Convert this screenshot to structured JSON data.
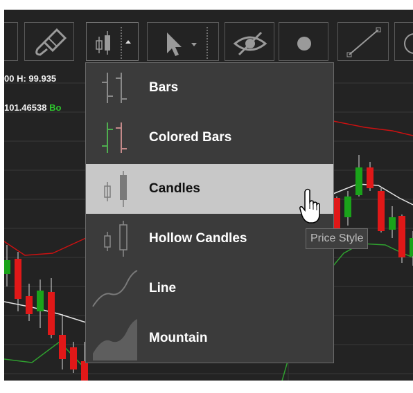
{
  "toolbar": {
    "tools": [
      {
        "icon": "paintbrush-icon"
      },
      {
        "icon": "chart-style-icon",
        "active": true
      },
      {
        "icon": "pointer-icon"
      },
      {
        "icon": "hide-eye-icon"
      },
      {
        "icon": "dot-icon"
      },
      {
        "icon": "line-draw-icon"
      }
    ]
  },
  "ohlc": {
    "line1": "00  H: 99.935",
    "line2_value": "101.46538",
    "line2_suffix": "Bo"
  },
  "menu": {
    "items": [
      {
        "label": "Bars",
        "icon": "bars-icon"
      },
      {
        "label": "Colored Bars",
        "icon": "colored-bars-icon"
      },
      {
        "label": "Candles",
        "icon": "candles-icon",
        "selected": true
      },
      {
        "label": "Hollow Candles",
        "icon": "hollow-candles-icon"
      },
      {
        "label": "Line",
        "icon": "line-chart-icon"
      },
      {
        "label": "Mountain",
        "icon": "mountain-chart-icon"
      }
    ]
  },
  "tooltip": {
    "text": "Price Style"
  },
  "colors": {
    "background": "#232323",
    "bull": "#1aa31a",
    "bear": "#e01818",
    "band": "#cc1111",
    "band_lower": "#2fa02f",
    "menu_bg": "#3b3b3b",
    "menu_selected": "#c8c8c8"
  }
}
